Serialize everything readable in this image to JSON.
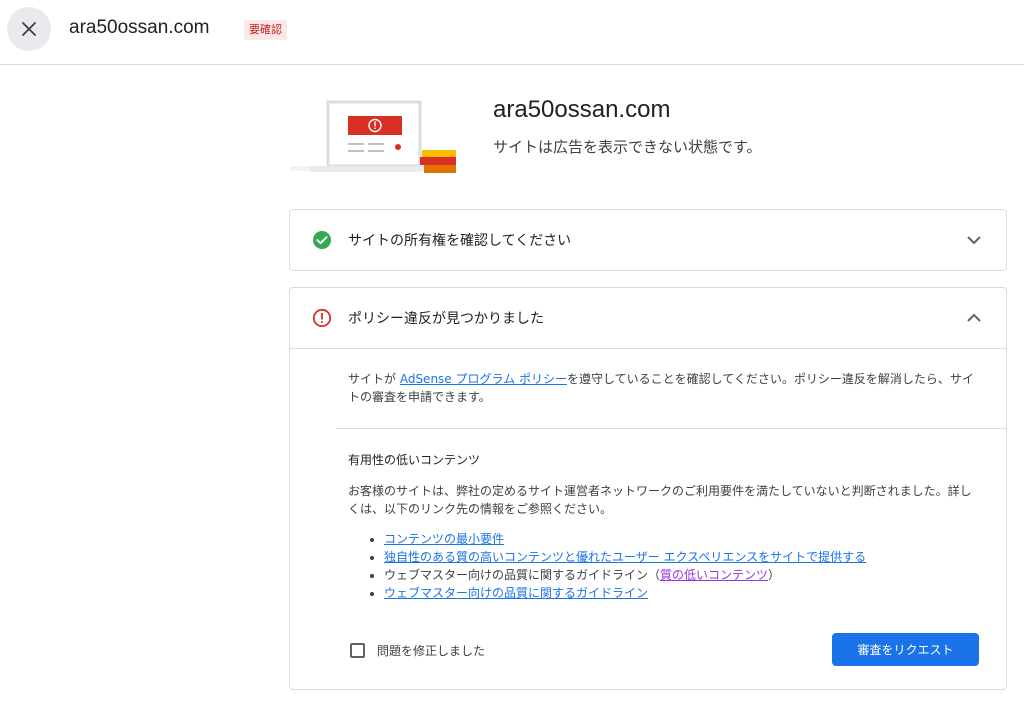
{
  "topbar": {
    "close_icon": "close-icon",
    "site_name": "ara50ossan.com",
    "badge": "要確認"
  },
  "hero": {
    "title": "ara50ossan.com",
    "subtitle": "サイトは広告を表示できない状態です。",
    "illustration_icon": "laptop-warning-illustration"
  },
  "ownership_panel": {
    "status_icon": "check-circle-icon",
    "title": "サイトの所有権を確認してください",
    "chevron": "chevron-down-icon"
  },
  "policy_panel": {
    "status_icon": "alert-circle-icon",
    "title": "ポリシー違反が見つかりました",
    "chevron": "chevron-up-icon",
    "intro_before": "サイトが ",
    "intro_link": "AdSense プログラム ポリシー",
    "intro_after": "を遵守していることを確認してください。ポリシー違反を解消したら、サイトの審査を申請できます。",
    "section_title": "有用性の低いコンテンツ",
    "section_desc": "お客様のサイトは、弊社の定めるサイト運営者ネットワークのご利用要件を満たしていないと判断されました。詳しくは、以下のリンク先の情報をご参照ください。",
    "requirements": [
      {
        "link": "コンテンツの最小要件"
      },
      {
        "link": "独自性のある質の高いコンテンツと優れたユーザー エクスペリエンスをサイトで提供する"
      },
      {
        "text_before": "ウェブマスター向けの品質に関するガイドライン（",
        "link": "質の低いコンテンツ",
        "text_after": "）"
      },
      {
        "link": "ウェブマスター向けの品質に関するガイドライン"
      }
    ],
    "checkbox_label": "問題を修正しました",
    "review_button": "審査をリクエスト"
  },
  "colors": {
    "accent": "#1a73e8",
    "success": "#34a853",
    "error": "#d93025",
    "visited_link": "#9334e6"
  }
}
